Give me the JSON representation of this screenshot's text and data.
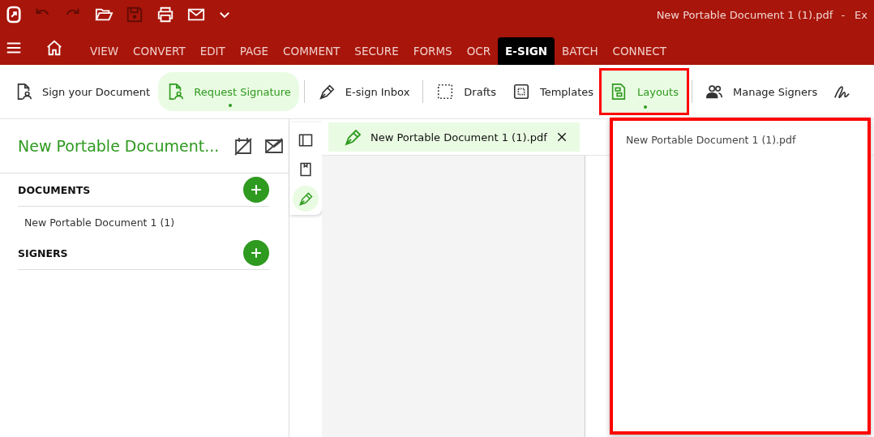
{
  "window": {
    "title": "New Portable Document 1 (1).pdf",
    "separator": "-",
    "app_name": "Ex"
  },
  "quick_access": [
    {
      "kind": "undo",
      "disabled": true
    },
    {
      "kind": "redo",
      "disabled": true
    },
    {
      "kind": "open",
      "disabled": false
    },
    {
      "kind": "save",
      "disabled": true
    },
    {
      "kind": "print",
      "disabled": false
    },
    {
      "kind": "mail",
      "disabled": false
    },
    {
      "kind": "more",
      "disabled": false
    }
  ],
  "menu_tabs": [
    {
      "label": "VIEW",
      "selected": false
    },
    {
      "label": "CONVERT",
      "selected": false
    },
    {
      "label": "EDIT",
      "selected": false
    },
    {
      "label": "PAGE",
      "selected": false
    },
    {
      "label": "COMMENT",
      "selected": false
    },
    {
      "label": "SECURE",
      "selected": false
    },
    {
      "label": "FORMS",
      "selected": false
    },
    {
      "label": "OCR",
      "selected": false
    },
    {
      "label": "E-SIGN",
      "selected": true
    },
    {
      "label": "BATCH",
      "selected": false
    },
    {
      "label": "CONNECT",
      "selected": false
    }
  ],
  "ribbon": [
    {
      "kind": "sign",
      "label": "Sign your Document",
      "selected": false,
      "highlighted": false
    },
    {
      "kind": "request",
      "label": "Request Signature",
      "selected": true,
      "highlighted": false
    },
    {
      "kind": "inbox",
      "label": "E-sign Inbox",
      "selected": false,
      "highlighted": false
    },
    {
      "kind": "drafts",
      "label": "Drafts",
      "selected": false,
      "highlighted": false
    },
    {
      "kind": "templates",
      "label": "Templates",
      "selected": false,
      "highlighted": false
    },
    {
      "kind": "layouts",
      "label": "Layouts",
      "selected": true,
      "highlighted": true
    },
    {
      "kind": "signers",
      "label": "Manage Signers",
      "selected": false,
      "highlighted": false
    },
    {
      "kind": "signature",
      "selected": false,
      "highlighted": false
    }
  ],
  "sidebar": {
    "title": "New Portable Document...",
    "sections": [
      {
        "heading": "DOCUMENTS",
        "items": [
          "New Portable Document 1 (1)"
        ]
      },
      {
        "heading": "SIGNERS"
      }
    ]
  },
  "side_tools": [
    {
      "kind": "panel",
      "selected": false
    },
    {
      "kind": "bookmark",
      "selected": false
    },
    {
      "kind": "pen",
      "selected": true
    }
  ],
  "doc_tab": {
    "label": "New Portable Document 1 (1).pdf"
  },
  "layouts_dropdown": {
    "highlighted": true,
    "items": [
      "New Portable Document 1 (1).pdf"
    ]
  }
}
